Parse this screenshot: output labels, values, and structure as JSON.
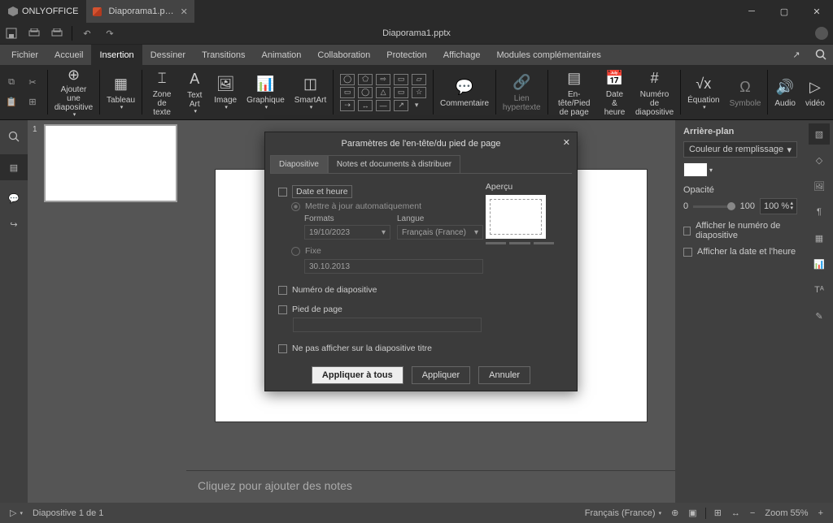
{
  "titlebar": {
    "app_name": "ONLYOFFICE",
    "file_tab": "Diaporama1.p…"
  },
  "quickbar": {
    "doc_name": "Diaporama1.pptx"
  },
  "menubar": {
    "items": [
      "Fichier",
      "Accueil",
      "Insertion",
      "Dessiner",
      "Transitions",
      "Animation",
      "Collaboration",
      "Protection",
      "Affichage",
      "Modules complémentaires"
    ],
    "active_index": 2
  },
  "ribbon": {
    "add_slide": "Ajouter une\ndiapositive",
    "table": "Tableau",
    "text_zone": "Zone de\ntexte",
    "text_art": "Text\nArt",
    "image": "Image",
    "chart": "Graphique",
    "smartart": "SmartArt",
    "comment": "Commentaire",
    "hyperlink": "Lien\nhypertexte",
    "header_footer": "En-tête/Pied\nde page",
    "date_time": "Date &\nheure",
    "slide_number": "Numéro de\ndiapositive",
    "equation": "Équation",
    "symbol": "Symbole",
    "audio": "Audio",
    "video": "vidéo"
  },
  "right_panel": {
    "bg": "Arrière-plan",
    "fill": "Couleur de remplissage",
    "opacity_label": "Opacité",
    "opacity_min": "0",
    "opacity_max": "100",
    "opacity_value": "100 %",
    "check1": "Afficher le numéro de diapositive",
    "check2": "Afficher la date et l'heure"
  },
  "notes": "Cliquez pour ajouter des notes",
  "status": {
    "slide_info": "Diapositive 1 de 1",
    "language": "Français (France)",
    "zoom": "Zoom 55%"
  },
  "dialog": {
    "title": "Paramètres de l'en-tête/du pied de page",
    "tab1": "Diapositive",
    "tab2": "Notes et documents à distribuer",
    "date_time": "Date et heure",
    "auto_update": "Mettre à jour automatiquement",
    "formats": "Formats",
    "format_value": "19/10/2023",
    "lang_label": "Langue",
    "lang_value": "Français (France)",
    "fixed": "Fixe",
    "fixed_value": "30.10.2013",
    "slide_num": "Numéro de diapositive",
    "footer": "Pied de page",
    "dont_show": "Ne pas afficher sur la diapositive titre",
    "preview": "Aperçu",
    "apply_all": "Appliquer à tous",
    "apply": "Appliquer",
    "cancel": "Annuler"
  },
  "slide_num_label": "1"
}
